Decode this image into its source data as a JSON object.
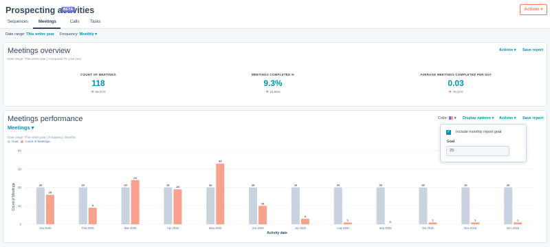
{
  "header": {
    "title": "Prospecting activities",
    "badge": "BETA",
    "actions_label": "Actions ▾"
  },
  "tabs": [
    {
      "label": "Sequences",
      "active": false
    },
    {
      "label": "Meetings",
      "active": true
    },
    {
      "label": "Calls",
      "active": false
    },
    {
      "label": "Tasks",
      "active": false
    }
  ],
  "filters": {
    "date_label": "Date range:",
    "date_value": "This entire year",
    "frequency_label": "Frequency:",
    "frequency_value": "Monthly ▾"
  },
  "overview": {
    "title": "Meetings overview",
    "subtitle": "Date range: This entire year  |  Compared To: Last year",
    "actions": "Actions ▾",
    "save": "Save report",
    "kpis": [
      {
        "label": "COUNT OF MEETINGS",
        "value": "118",
        "change": "69.27%"
      },
      {
        "label": "MEETINGS COMPLETED %",
        "value": "9.3%",
        "change": "15.08%"
      },
      {
        "label": "AVERAGE MEETINGS COMPLETED PER DAY",
        "value": "0.03",
        "change": "75.21%"
      }
    ]
  },
  "performance": {
    "title": "Meetings performance",
    "selector": "Meetings ▾",
    "subtitle": "Date range: This entire year  |  Frequency: Monthly",
    "color_label": "Color:",
    "display_options": "Display options ▾",
    "actions": "Actions ▾",
    "save": "Save report",
    "legend": [
      {
        "label": "Goal",
        "color": "#c9d3df"
      },
      {
        "label": "Count of Meetings",
        "color": "#f8a18c"
      }
    ]
  },
  "popover": {
    "checkbox_label": "Include monthly report goal",
    "checked": true,
    "goal_label": "Goal",
    "goal_value": "20"
  },
  "chart_data": {
    "type": "bar",
    "categories": [
      "Jan 2025",
      "Feb 2025",
      "Mar 2025",
      "Apr 2025",
      "May 2025",
      "Jun 2025",
      "Jul 2025",
      "Aug 2025",
      "Sep 2025",
      "Oct 2025",
      "Nov 2025",
      "Dec 2025"
    ],
    "series": [
      {
        "name": "Goal",
        "values": [
          20,
          20,
          20,
          20,
          20,
          20,
          20,
          20,
          20,
          20,
          20,
          20
        ],
        "color": "#c9d3df"
      },
      {
        "name": "Count of Meetings",
        "values": [
          16,
          9,
          24,
          19,
          33,
          10,
          3,
          1,
          0,
          1,
          1,
          1
        ],
        "color": "#f8a18c"
      }
    ],
    "xlabel": "Activity date",
    "ylabel": "Count of Meetings",
    "yticks": [
      0,
      10,
      20,
      30,
      40
    ],
    "ylim": [
      0,
      40
    ],
    "grid": true
  }
}
